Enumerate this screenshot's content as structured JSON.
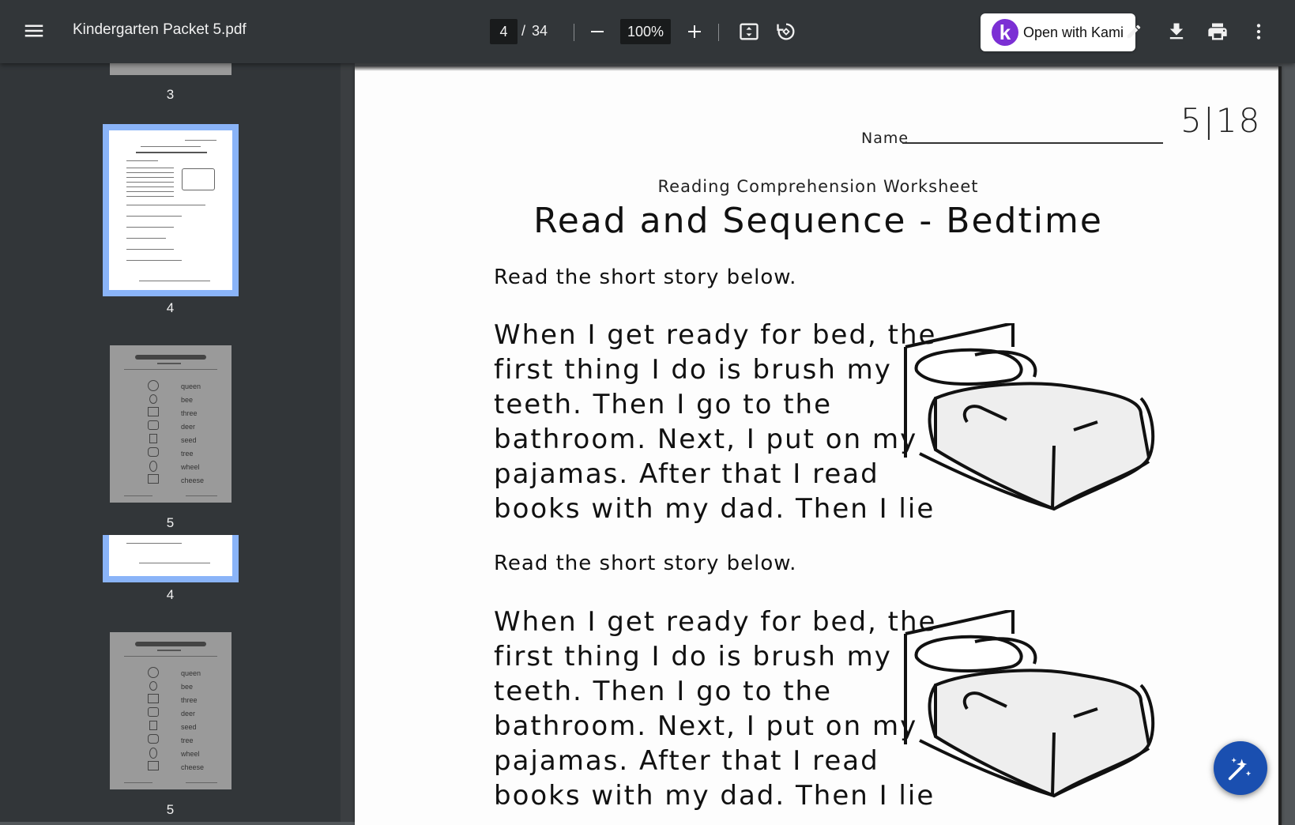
{
  "toolbar": {
    "title": "Kindergarten Packet 5.pdf",
    "current_page": "4",
    "page_separator": "/",
    "total_pages": "34",
    "zoom": "100%",
    "kami_label": "Open with Kami",
    "kami_logo_letter": "k",
    "icons": [
      "menu-icon",
      "zoom-out-icon",
      "zoom-in-icon",
      "fit-page-icon",
      "rotate-icon",
      "edit-icon",
      "download-icon",
      "print-icon",
      "more-vert-icon"
    ]
  },
  "sidebar": {
    "thumbnails": [
      {
        "label": "3"
      },
      {
        "label": "4"
      },
      {
        "label": "5"
      },
      {
        "label": "4"
      },
      {
        "label": "5"
      }
    ],
    "mini_words": [
      "queen",
      "bee",
      "three",
      "deer",
      "seed",
      "tree",
      "wheel",
      "cheese"
    ]
  },
  "document": {
    "name_label": "Name",
    "handwritten_date": "5|18",
    "subtitle": "Reading Comprehension Worksheet",
    "title": "Read and Sequence - Bedtime",
    "instruction": "Read the short story below.",
    "story_lines": [
      "When I get ready for bed, the",
      "first thing I do is brush my",
      "teeth.  Then I go to the",
      "bathroom.  Next, I put on my",
      "pajamas.  After that I read",
      "books with my dad.  Then I lie"
    ],
    "instruction_2": "Read the short story below.",
    "story_lines_2": [
      "When I get ready for bed, the",
      "first thing I do is brush my",
      "teeth.  Then I go to the",
      "bathroom.  Next, I put on my",
      "pajamas.  After that I read",
      "books with my dad.  Then I lie"
    ]
  },
  "colors": {
    "toolbar_bg": "#323639",
    "selection": "#8ab4f8",
    "kami_purple": "#7b2fd4",
    "fab_blue": "#1a4fb0"
  }
}
